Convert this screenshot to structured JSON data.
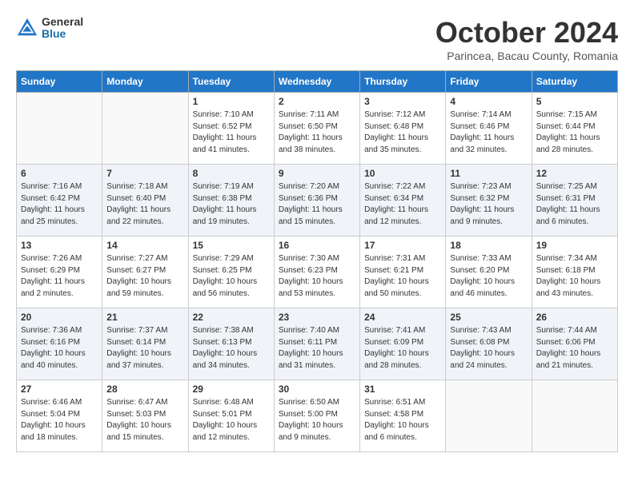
{
  "logo": {
    "general": "General",
    "blue": "Blue"
  },
  "title": "October 2024",
  "subtitle": "Parincea, Bacau County, Romania",
  "weekdays": [
    "Sunday",
    "Monday",
    "Tuesday",
    "Wednesday",
    "Thursday",
    "Friday",
    "Saturday"
  ],
  "weeks": [
    [
      {
        "day": "",
        "sunrise": "",
        "sunset": "",
        "daylight": ""
      },
      {
        "day": "",
        "sunrise": "",
        "sunset": "",
        "daylight": ""
      },
      {
        "day": "1",
        "sunrise": "Sunrise: 7:10 AM",
        "sunset": "Sunset: 6:52 PM",
        "daylight": "Daylight: 11 hours and 41 minutes."
      },
      {
        "day": "2",
        "sunrise": "Sunrise: 7:11 AM",
        "sunset": "Sunset: 6:50 PM",
        "daylight": "Daylight: 11 hours and 38 minutes."
      },
      {
        "day": "3",
        "sunrise": "Sunrise: 7:12 AM",
        "sunset": "Sunset: 6:48 PM",
        "daylight": "Daylight: 11 hours and 35 minutes."
      },
      {
        "day": "4",
        "sunrise": "Sunrise: 7:14 AM",
        "sunset": "Sunset: 6:46 PM",
        "daylight": "Daylight: 11 hours and 32 minutes."
      },
      {
        "day": "5",
        "sunrise": "Sunrise: 7:15 AM",
        "sunset": "Sunset: 6:44 PM",
        "daylight": "Daylight: 11 hours and 28 minutes."
      }
    ],
    [
      {
        "day": "6",
        "sunrise": "Sunrise: 7:16 AM",
        "sunset": "Sunset: 6:42 PM",
        "daylight": "Daylight: 11 hours and 25 minutes."
      },
      {
        "day": "7",
        "sunrise": "Sunrise: 7:18 AM",
        "sunset": "Sunset: 6:40 PM",
        "daylight": "Daylight: 11 hours and 22 minutes."
      },
      {
        "day": "8",
        "sunrise": "Sunrise: 7:19 AM",
        "sunset": "Sunset: 6:38 PM",
        "daylight": "Daylight: 11 hours and 19 minutes."
      },
      {
        "day": "9",
        "sunrise": "Sunrise: 7:20 AM",
        "sunset": "Sunset: 6:36 PM",
        "daylight": "Daylight: 11 hours and 15 minutes."
      },
      {
        "day": "10",
        "sunrise": "Sunrise: 7:22 AM",
        "sunset": "Sunset: 6:34 PM",
        "daylight": "Daylight: 11 hours and 12 minutes."
      },
      {
        "day": "11",
        "sunrise": "Sunrise: 7:23 AM",
        "sunset": "Sunset: 6:32 PM",
        "daylight": "Daylight: 11 hours and 9 minutes."
      },
      {
        "day": "12",
        "sunrise": "Sunrise: 7:25 AM",
        "sunset": "Sunset: 6:31 PM",
        "daylight": "Daylight: 11 hours and 6 minutes."
      }
    ],
    [
      {
        "day": "13",
        "sunrise": "Sunrise: 7:26 AM",
        "sunset": "Sunset: 6:29 PM",
        "daylight": "Daylight: 11 hours and 2 minutes."
      },
      {
        "day": "14",
        "sunrise": "Sunrise: 7:27 AM",
        "sunset": "Sunset: 6:27 PM",
        "daylight": "Daylight: 10 hours and 59 minutes."
      },
      {
        "day": "15",
        "sunrise": "Sunrise: 7:29 AM",
        "sunset": "Sunset: 6:25 PM",
        "daylight": "Daylight: 10 hours and 56 minutes."
      },
      {
        "day": "16",
        "sunrise": "Sunrise: 7:30 AM",
        "sunset": "Sunset: 6:23 PM",
        "daylight": "Daylight: 10 hours and 53 minutes."
      },
      {
        "day": "17",
        "sunrise": "Sunrise: 7:31 AM",
        "sunset": "Sunset: 6:21 PM",
        "daylight": "Daylight: 10 hours and 50 minutes."
      },
      {
        "day": "18",
        "sunrise": "Sunrise: 7:33 AM",
        "sunset": "Sunset: 6:20 PM",
        "daylight": "Daylight: 10 hours and 46 minutes."
      },
      {
        "day": "19",
        "sunrise": "Sunrise: 7:34 AM",
        "sunset": "Sunset: 6:18 PM",
        "daylight": "Daylight: 10 hours and 43 minutes."
      }
    ],
    [
      {
        "day": "20",
        "sunrise": "Sunrise: 7:36 AM",
        "sunset": "Sunset: 6:16 PM",
        "daylight": "Daylight: 10 hours and 40 minutes."
      },
      {
        "day": "21",
        "sunrise": "Sunrise: 7:37 AM",
        "sunset": "Sunset: 6:14 PM",
        "daylight": "Daylight: 10 hours and 37 minutes."
      },
      {
        "day": "22",
        "sunrise": "Sunrise: 7:38 AM",
        "sunset": "Sunset: 6:13 PM",
        "daylight": "Daylight: 10 hours and 34 minutes."
      },
      {
        "day": "23",
        "sunrise": "Sunrise: 7:40 AM",
        "sunset": "Sunset: 6:11 PM",
        "daylight": "Daylight: 10 hours and 31 minutes."
      },
      {
        "day": "24",
        "sunrise": "Sunrise: 7:41 AM",
        "sunset": "Sunset: 6:09 PM",
        "daylight": "Daylight: 10 hours and 28 minutes."
      },
      {
        "day": "25",
        "sunrise": "Sunrise: 7:43 AM",
        "sunset": "Sunset: 6:08 PM",
        "daylight": "Daylight: 10 hours and 24 minutes."
      },
      {
        "day": "26",
        "sunrise": "Sunrise: 7:44 AM",
        "sunset": "Sunset: 6:06 PM",
        "daylight": "Daylight: 10 hours and 21 minutes."
      }
    ],
    [
      {
        "day": "27",
        "sunrise": "Sunrise: 6:46 AM",
        "sunset": "Sunset: 5:04 PM",
        "daylight": "Daylight: 10 hours and 18 minutes."
      },
      {
        "day": "28",
        "sunrise": "Sunrise: 6:47 AM",
        "sunset": "Sunset: 5:03 PM",
        "daylight": "Daylight: 10 hours and 15 minutes."
      },
      {
        "day": "29",
        "sunrise": "Sunrise: 6:48 AM",
        "sunset": "Sunset: 5:01 PM",
        "daylight": "Daylight: 10 hours and 12 minutes."
      },
      {
        "day": "30",
        "sunrise": "Sunrise: 6:50 AM",
        "sunset": "Sunset: 5:00 PM",
        "daylight": "Daylight: 10 hours and 9 minutes."
      },
      {
        "day": "31",
        "sunrise": "Sunrise: 6:51 AM",
        "sunset": "Sunset: 4:58 PM",
        "daylight": "Daylight: 10 hours and 6 minutes."
      },
      {
        "day": "",
        "sunrise": "",
        "sunset": "",
        "daylight": ""
      },
      {
        "day": "",
        "sunrise": "",
        "sunset": "",
        "daylight": ""
      }
    ]
  ]
}
